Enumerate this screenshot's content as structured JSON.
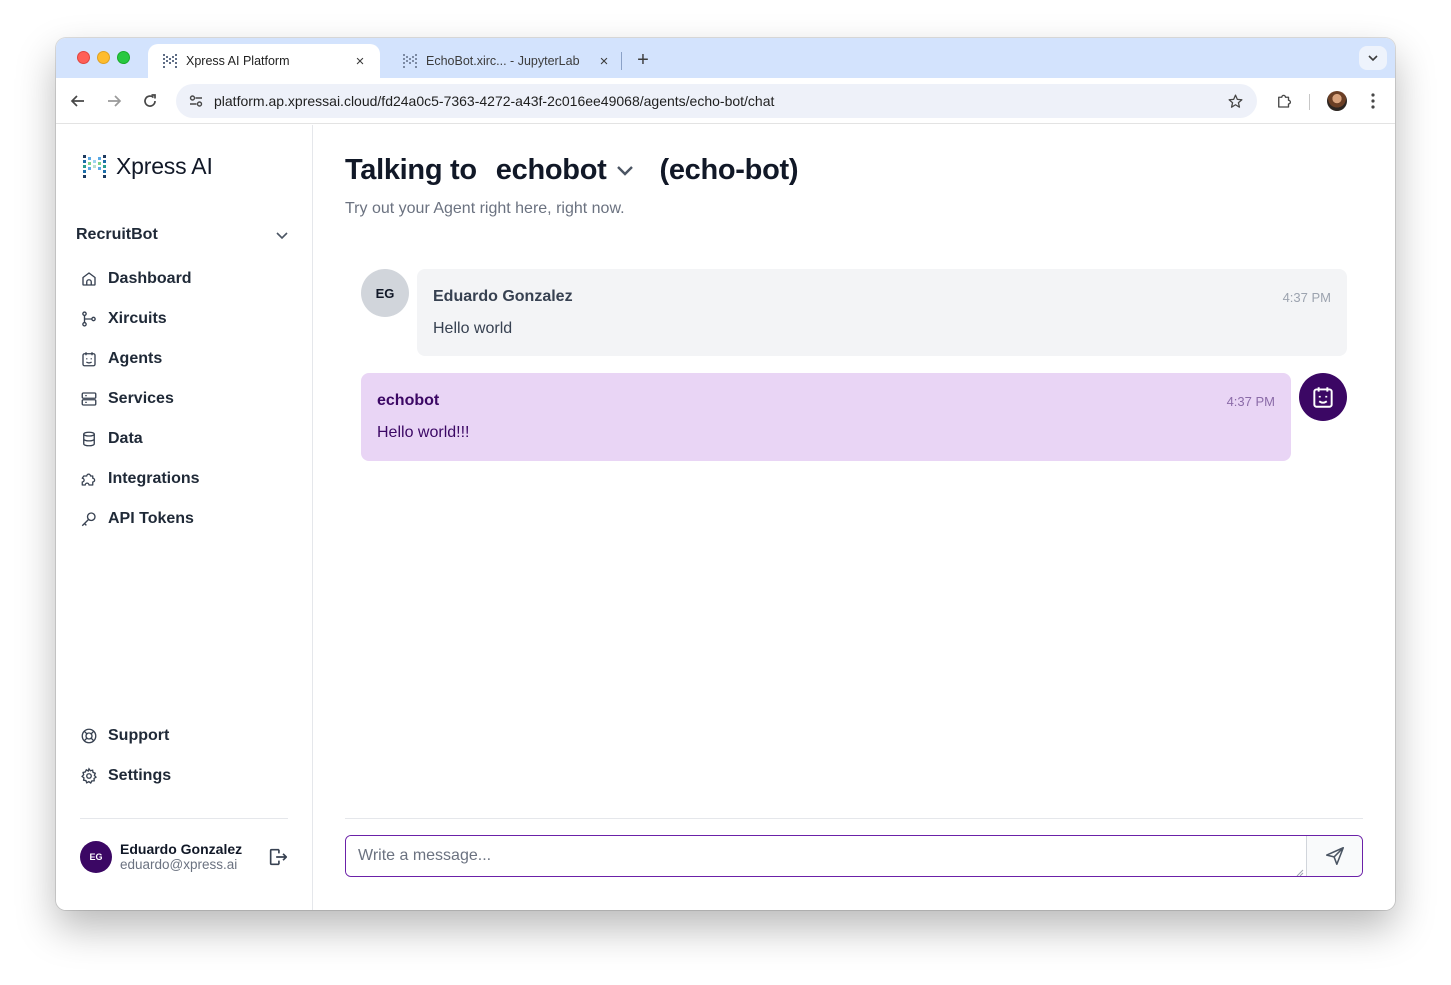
{
  "browser": {
    "tabs": [
      {
        "title": "Xpress AI Platform",
        "active": true
      },
      {
        "title": "EchoBot.xirc... - JupyterLab",
        "active": false
      }
    ],
    "close_glyph": "×",
    "new_tab_glyph": "+",
    "url": "platform.ap.xpressai.cloud/fd24a0c5-7363-4272-a43f-2c016ee49068/agents/echo-bot/chat"
  },
  "sidebar": {
    "logo_text": "Xpress AI",
    "workspace": "RecruitBot",
    "nav": [
      {
        "label": "Dashboard",
        "icon": "home-icon"
      },
      {
        "label": "Xircuits",
        "icon": "flow-icon"
      },
      {
        "label": "Agents",
        "icon": "agent-icon"
      },
      {
        "label": "Services",
        "icon": "server-icon"
      },
      {
        "label": "Data",
        "icon": "database-icon"
      },
      {
        "label": "Integrations",
        "icon": "puzzle-icon"
      },
      {
        "label": "API Tokens",
        "icon": "key-icon"
      }
    ],
    "bottom_nav": [
      {
        "label": "Support",
        "icon": "lifebuoy-icon"
      },
      {
        "label": "Settings",
        "icon": "gear-icon"
      }
    ],
    "user": {
      "initials": "EG",
      "name": "Eduardo Gonzalez",
      "email": "eduardo@xpress.ai"
    }
  },
  "main": {
    "heading_prefix": "Talking to",
    "agent_name": "echobot",
    "agent_slug": "(echo-bot)",
    "subtitle": "Try out your Agent right here, right now.",
    "messages": [
      {
        "sender": "Eduardo Gonzalez",
        "initials": "EG",
        "time": "4:37 PM",
        "text": "Hello world"
      },
      {
        "sender": "echobot",
        "time": "4:37 PM",
        "text": "Hello world!!!"
      }
    ],
    "composer": {
      "placeholder": "Write a message..."
    }
  },
  "colors": {
    "brand_purple": "#3b0764",
    "bot_bubble": "#e9d5f5",
    "user_bubble": "#f3f4f6",
    "tabstrip": "#d3e3fd"
  }
}
